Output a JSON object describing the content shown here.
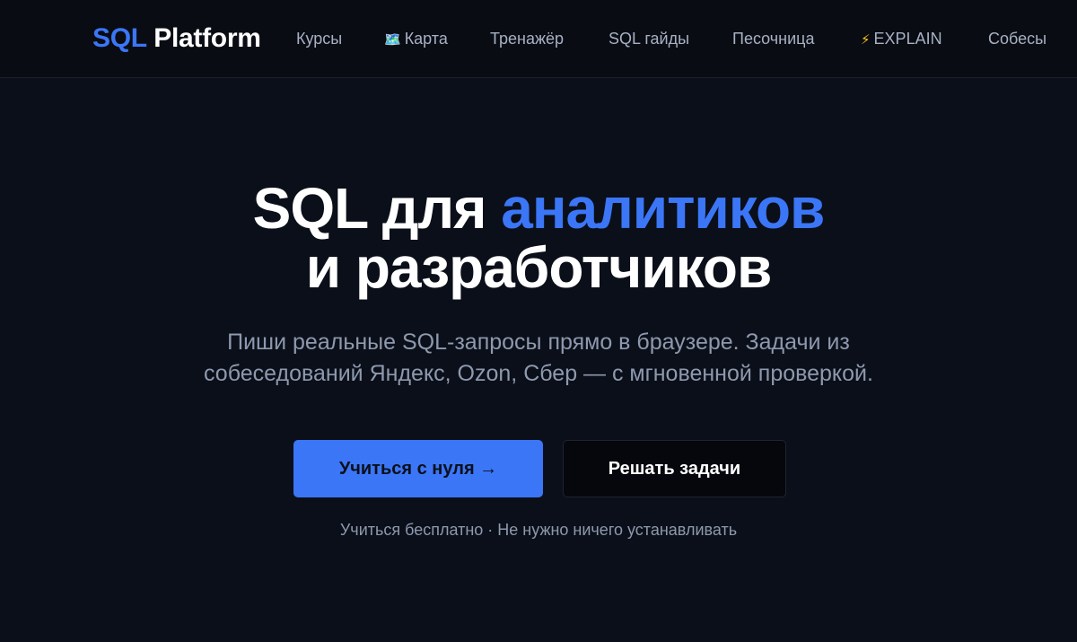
{
  "brand": {
    "accent": "SQL",
    "rest": "Platform"
  },
  "nav": {
    "courses": "Курсы",
    "map_icon": "🗺️",
    "map": "Карта",
    "trainer": "Тренажёр",
    "guides": "SQL гайды",
    "sandbox": "Песочница",
    "explain_icon": "⚡",
    "explain": "EXPLAIN",
    "interviews": "Собесы"
  },
  "hero": {
    "title_part1": "SQL для ",
    "title_accent": "аналитиков",
    "title_line2": "и разработчиков",
    "subtitle_line1": "Пиши реальные SQL-запросы прямо в браузере. Задачи из",
    "subtitle_line2": "собеседований Яндекс, Ozon, Сбер — с мгновенной проверкой.",
    "primary_button": "Учиться с нуля →",
    "secondary_button": "Решать задачи",
    "note": "Учиться бесплатно · Не нужно ничего устанавливать"
  },
  "colors": {
    "background": "#0b0f19",
    "navbar": "#0a0c13",
    "accent": "#3b76f6",
    "muted_text": "#8d99ae",
    "nav_text": "#a7b1c4"
  },
  "icons": {
    "map": "map-icon",
    "explain": "lightning-icon"
  }
}
